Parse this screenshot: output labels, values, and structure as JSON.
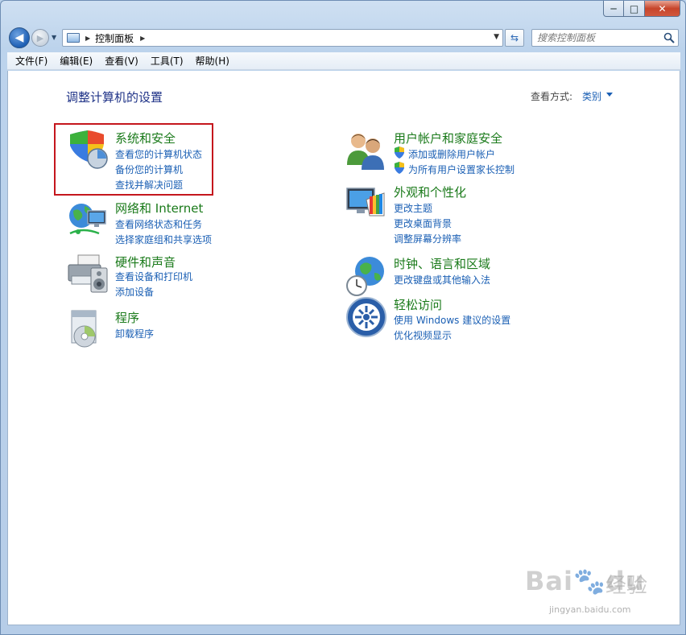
{
  "window": {
    "caption": {
      "minimize": "─",
      "maximize": "□",
      "close": "✕"
    }
  },
  "navbar": {
    "back_icon": "arrow-left-icon",
    "forward_icon": "arrow-right-icon",
    "address": {
      "text": "控制面板",
      "separator": "▶"
    },
    "search": {
      "placeholder": "搜索控制面板"
    }
  },
  "menubar": {
    "items": [
      {
        "label": "文件(F)"
      },
      {
        "label": "编辑(E)"
      },
      {
        "label": "查看(V)"
      },
      {
        "label": "工具(T)"
      },
      {
        "label": "帮助(H)"
      }
    ]
  },
  "content": {
    "title": "调整计算机的设置",
    "view_by_label": "查看方式:",
    "view_by_value": "类别",
    "categories": [
      {
        "title": "系统和安全",
        "icon": "shield-chart-icon",
        "links": [
          "查看您的计算机状态",
          "备份您的计算机",
          "查找并解决问题"
        ]
      },
      {
        "title": "网络和 Internet",
        "icon": "network-globe-icon",
        "links": [
          "查看网络状态和任务",
          "选择家庭组和共享选项"
        ]
      },
      {
        "title": "硬件和声音",
        "icon": "printer-icon",
        "links": [
          "查看设备和打印机",
          "添加设备"
        ]
      },
      {
        "title": "程序",
        "icon": "program-disc-icon",
        "links": [
          "卸载程序"
        ]
      },
      {
        "title": "用户帐户和家庭安全",
        "icon": "users-icon",
        "links": [
          "添加或删除用户帐户",
          "为所有用户设置家长控制"
        ]
      },
      {
        "title": "外观和个性化",
        "icon": "monitor-palette-icon",
        "links": [
          "更改主题",
          "更改桌面背景",
          "调整屏幕分辨率"
        ]
      },
      {
        "title": "时钟、语言和区域",
        "icon": "clock-globe-icon",
        "links": [
          "更改键盘或其他输入法"
        ]
      },
      {
        "title": "轻松访问",
        "icon": "ease-of-access-icon",
        "links": [
          "使用 Windows 建议的设置",
          "优化视频显示"
        ]
      }
    ]
  },
  "watermark": {
    "brand": "Bai",
    "brand_du": "du",
    "cn": "经验",
    "url": "jingyan.baidu.com"
  },
  "colors": {
    "title_green": "#1a7a1a",
    "link_blue": "#1a5fb4",
    "highlight_red": "#c5161d"
  }
}
